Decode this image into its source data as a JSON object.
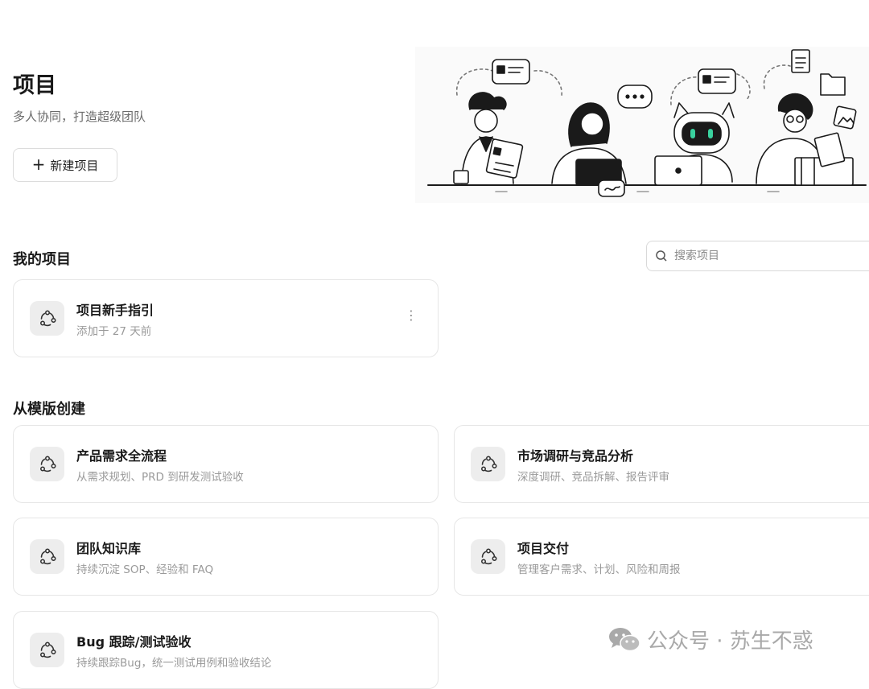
{
  "header": {
    "title": "项目",
    "subtitle": "多人协同，打造超级团队",
    "new_project_label": "新建项目"
  },
  "my_projects": {
    "title": "我的项目",
    "search_placeholder": "搜索项目",
    "items": [
      {
        "name": "项目新手指引",
        "meta": "添加于 27 天前"
      }
    ]
  },
  "templates": {
    "title": "从模版创建",
    "items": [
      {
        "name": "产品需求全流程",
        "desc": "从需求规划、PRD 到研发测试验收"
      },
      {
        "name": "市场调研与竞品分析",
        "desc": "深度调研、竞品拆解、报告评审"
      },
      {
        "name": "团队知识库",
        "desc": "持续沉淀 SOP、经验和 FAQ"
      },
      {
        "name": "项目交付",
        "desc": "管理客户需求、计划、风险和周报"
      },
      {
        "name": "Bug 跟踪/测试验收",
        "desc": "持续跟踪Bug，统一测试用例和验收结论"
      }
    ]
  },
  "watermark": {
    "text": "公众号 · 苏生不惑"
  },
  "icons": {
    "project": "project-share-icon",
    "search": "search-icon",
    "more": "more-vertical-icon",
    "add": "plus-icon",
    "wechat": "wechat-icon"
  },
  "colors": {
    "background": "#ffffff",
    "card_border": "#e6e6e6",
    "icon_bg": "#ededed",
    "muted_text": "#9a9a9a"
  }
}
